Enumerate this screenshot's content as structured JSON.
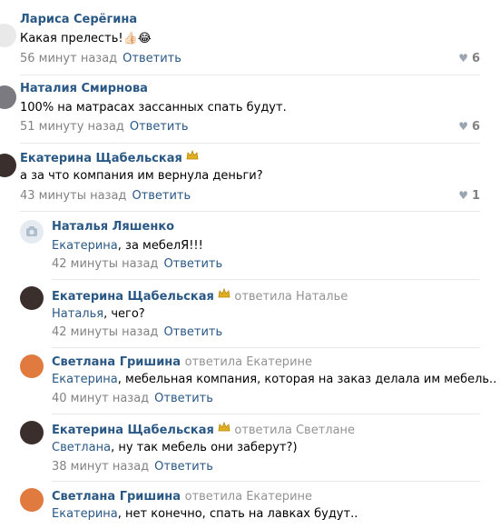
{
  "comments": [
    {
      "author": "Лариса Серёгина",
      "text": "Какая прелесть!👍🏻😂",
      "time": "56 минут назад",
      "reply": "Ответить",
      "likes": "6",
      "avatar_color": "#e9e9e9"
    },
    {
      "author": "Наталия Смирнова",
      "text": "100% на матрасах зассанных спать будут.",
      "time": "51 минуту назад",
      "reply": "Ответить",
      "likes": "6",
      "avatar_color": "#7a7a80"
    },
    {
      "author": "Екатерина Щабельская",
      "text": "а за что компания им вернула деньги?",
      "time": "43 минуты назад",
      "reply": "Ответить",
      "likes": "1",
      "avatar_color": "#3a2f2c"
    }
  ],
  "replies": [
    {
      "author": "Наталья Ляшенко",
      "reply_to": "",
      "mention": "Екатерина",
      "text": ", за мебелЯ!!!",
      "time": "42 минуты назад",
      "reply": "Ответить",
      "avatar_color": "#e5ebf1"
    },
    {
      "author": "Екатерина Щабельская",
      "reply_to": "ответила Наталье",
      "mention": "Наталья",
      "text": ", чего?",
      "time": "42 минуты назад",
      "reply": "Ответить",
      "avatar_color": "#3a2f2c"
    },
    {
      "author": "Светлана Гришина",
      "reply_to": "ответила Екатерине",
      "mention": "Екатерина",
      "text": ", мебельная компания, которая на заказ делала им мебель..",
      "time": "40 минут назад",
      "reply": "Ответить",
      "avatar_color": "#e07a3e"
    },
    {
      "author": "Екатерина Щабельская",
      "reply_to": "ответила Светлане",
      "mention": "Светлана",
      "text": ", ну так мебель они заберут?)",
      "time": "38 минут назад",
      "reply": "Ответить",
      "avatar_color": "#3a2f2c"
    },
    {
      "author": "Светлана Гришина",
      "reply_to": "ответила Екатерине",
      "mention": "Екатерина",
      "text": ", нет конечно, спать на лавках будут..",
      "time": "",
      "reply": "",
      "avatar_color": "#e07a3e"
    }
  ],
  "colors": {
    "link": "#2a5885",
    "meta": "#828282",
    "separator": "#e7e8ec"
  }
}
